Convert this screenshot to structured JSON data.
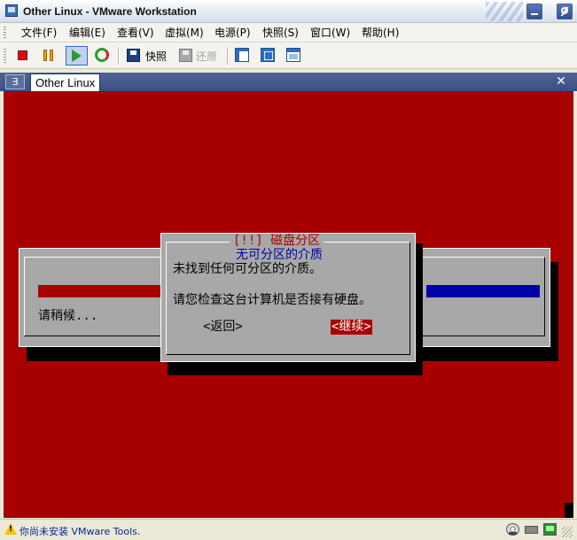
{
  "window": {
    "title": "Other Linux - VMware Workstation"
  },
  "menu": {
    "items": [
      "文件(F)",
      "编辑(E)",
      "查看(V)",
      "虚拟(M)",
      "电源(P)",
      "快照(S)",
      "窗口(W)",
      "帮助(H)"
    ]
  },
  "toolbar": {
    "snapshot_label": "快照",
    "revert_label": "还原"
  },
  "tabs": {
    "menu_glyph": "∃",
    "items": [
      {
        "label": "Other Linux",
        "active": true
      }
    ]
  },
  "console": {
    "progress_window": {
      "wait_text": "请稍候..."
    },
    "dialog": {
      "title": "[!!] 磁盘分区",
      "subtitle": "无可分区的介质",
      "message_line1": "未找到任何可分区的介质。",
      "message_line2": "请您检查这台计算机是否接有硬盘。",
      "back_label": "<返回>",
      "continue_label": "<继续>",
      "selected": "continue"
    },
    "colors": {
      "background": "#a80000",
      "dialog": "#a8a8a8",
      "title": "#a80000",
      "subtitle": "#0000a8",
      "progress": "#0000a8"
    }
  },
  "statusbar": {
    "message": "你尚未安装 VMware Tools.",
    "icons": [
      "hard-disk-icon",
      "cdrom-icon",
      "network-icon"
    ]
  }
}
